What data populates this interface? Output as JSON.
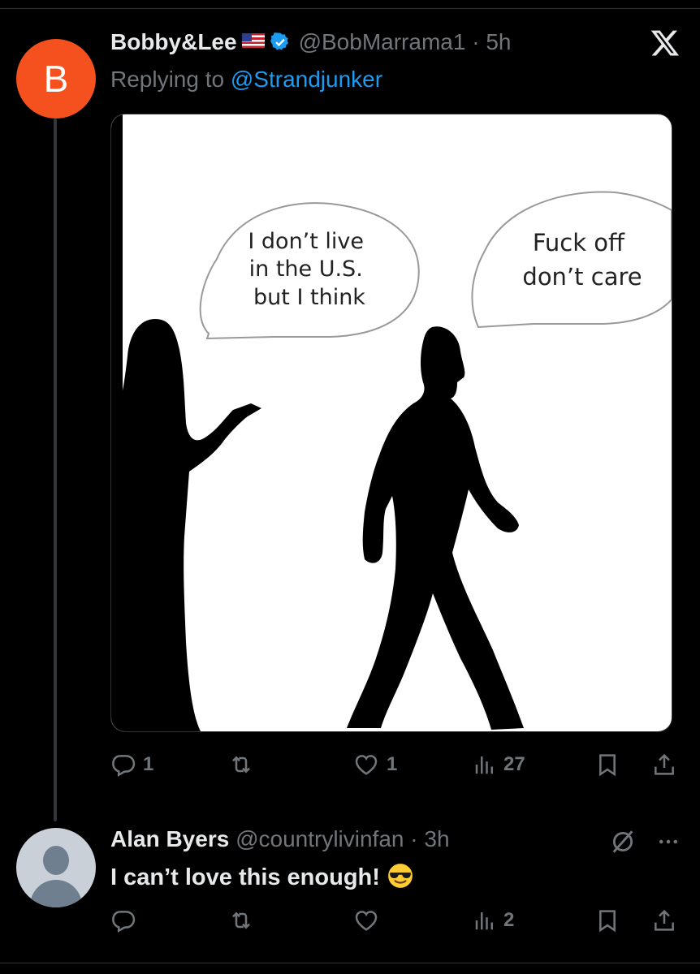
{
  "tweet": {
    "avatar_letter": "B",
    "name": "Bobby&Lee",
    "handle": "@BobMarrama1",
    "time": "5h",
    "replying_prefix": "Replying to",
    "replying_to": "@Strandjunker",
    "image": {
      "left_bubble": [
        "I don’t live",
        "in the U.S.",
        "but I think"
      ],
      "right_bubble": [
        "Fuck off",
        "don’t care"
      ]
    },
    "stats": {
      "replies": "1",
      "retweets": "",
      "likes": "1",
      "views": "27"
    }
  },
  "reply": {
    "name": "Alan Byers",
    "handle": "@countrylivinfan",
    "time": "3h",
    "text": "I can’t love this enough!",
    "emoji": "smiling-face-with-sunglasses",
    "stats": {
      "replies": "",
      "retweets": "",
      "likes": "",
      "views": "2"
    }
  },
  "colors": {
    "accent": "#1d9bf0",
    "avatar": "#f4511e",
    "muted": "#71767b"
  },
  "icons": [
    "x-logo-icon",
    "verified-badge-icon",
    "reply-icon",
    "retweet-icon",
    "like-icon",
    "views-icon",
    "bookmark-icon",
    "share-icon",
    "grok-icon",
    "more-icon"
  ]
}
